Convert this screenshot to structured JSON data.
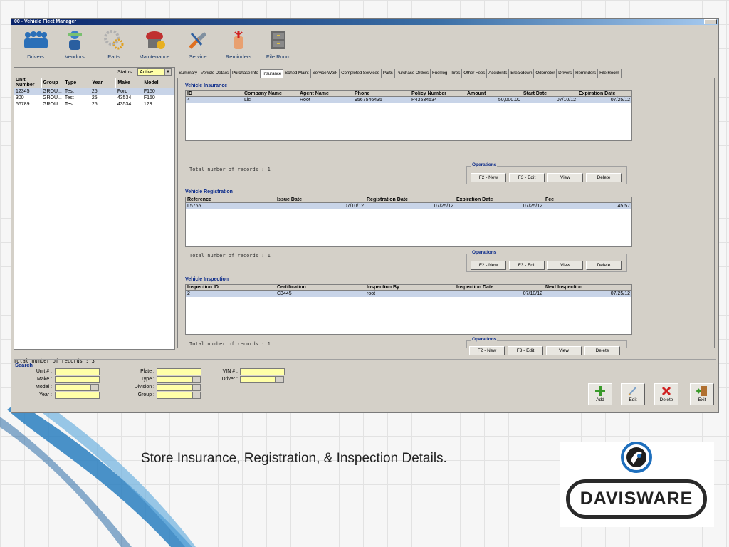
{
  "window": {
    "title": "00 - Vehicle Fleet Manager"
  },
  "toolbar": [
    {
      "label": "Drivers",
      "icon": "drivers-icon"
    },
    {
      "label": "Vendors",
      "icon": "vendors-icon"
    },
    {
      "label": "Parts",
      "icon": "parts-icon"
    },
    {
      "label": "Maintenance",
      "icon": "maintenance-icon"
    },
    {
      "label": "Service",
      "icon": "service-icon"
    },
    {
      "label": "Reminders",
      "icon": "reminders-icon"
    },
    {
      "label": "File Room",
      "icon": "file-room-icon"
    }
  ],
  "left": {
    "status_label": "Status :",
    "status_value": "Active",
    "columns": [
      "Unit Number",
      "Group",
      "Type",
      "Year",
      "Make",
      "Model"
    ],
    "rows": [
      [
        "12345",
        "GROU...",
        "Test",
        "25",
        "Ford",
        "F150"
      ],
      [
        "300",
        "GROU...",
        "Test",
        "25",
        "43534",
        "F150"
      ],
      [
        "56789",
        "GROU...",
        "Test",
        "25",
        "43534",
        "123"
      ]
    ],
    "total": "Total number of records : 3"
  },
  "tabs": [
    "Summary",
    "Vehicle Details",
    "Purchase Info",
    "Insurance",
    "Sched Maint",
    "Service Work",
    "Completed Services",
    "Parts",
    "Purchase Orders",
    "Fuel log",
    "Tires",
    "Other Fees",
    "Accidents",
    "Breakdown",
    "Odometer",
    "Drivers",
    "Reminders",
    "File Room"
  ],
  "active_tab": "Insurance",
  "insurance": {
    "title": "Vehicle Insurance",
    "columns": [
      "ID",
      "Company Name",
      "Agent Name",
      "Phone",
      "Policy Number",
      "Amount",
      "Start Date",
      "Expiration Date"
    ],
    "rows": [
      [
        "4",
        "Lic",
        "Root",
        "9567546435",
        "P43534534",
        "50,000.00",
        "07/10/12",
        "07/25/12"
      ]
    ],
    "total": "Total number of records : 1"
  },
  "registration": {
    "title": "Vehicle Registration",
    "columns": [
      "Reference",
      "Issue Date",
      "Registration Date",
      "Expiration Date",
      "Fee"
    ],
    "rows": [
      [
        "L5765",
        "07/10/12",
        "07/25/12",
        "07/25/12",
        "45.57"
      ]
    ],
    "total": "Total number of records : 1"
  },
  "inspection": {
    "title": "Vehicle Inspection",
    "columns": [
      "Inspection ID",
      "Certification",
      "Inspection By",
      "Inspection Date",
      "Next Inspection"
    ],
    "rows": [
      [
        "2",
        "C3445",
        "root",
        "07/10/12",
        "07/25/12"
      ]
    ],
    "total": "Total number of records : 1"
  },
  "operations": {
    "title": "Operations",
    "new": "F2 - New",
    "edit": "F3 - Edit",
    "view": "View",
    "delete": "Delete"
  },
  "search": {
    "title": "Search",
    "unit": "Unit # :",
    "make": "Make :",
    "model": "Model :",
    "year": "Year :",
    "plate": "Plate :",
    "type": "Type :",
    "division": "Division :",
    "group": "Group :",
    "vin": "VIN # :",
    "driver": "Driver :"
  },
  "actions": {
    "add": "Add",
    "edit": "Edit",
    "delete": "Delete",
    "exit": "Exit"
  },
  "caption": "Store Insurance, Registration, & Inspection Details.",
  "logo": {
    "text": "DAVISWARE"
  },
  "colors": {
    "accent": "#0a2a8a",
    "input": "#ffffa8",
    "selected_row": "#c8d4e8"
  }
}
